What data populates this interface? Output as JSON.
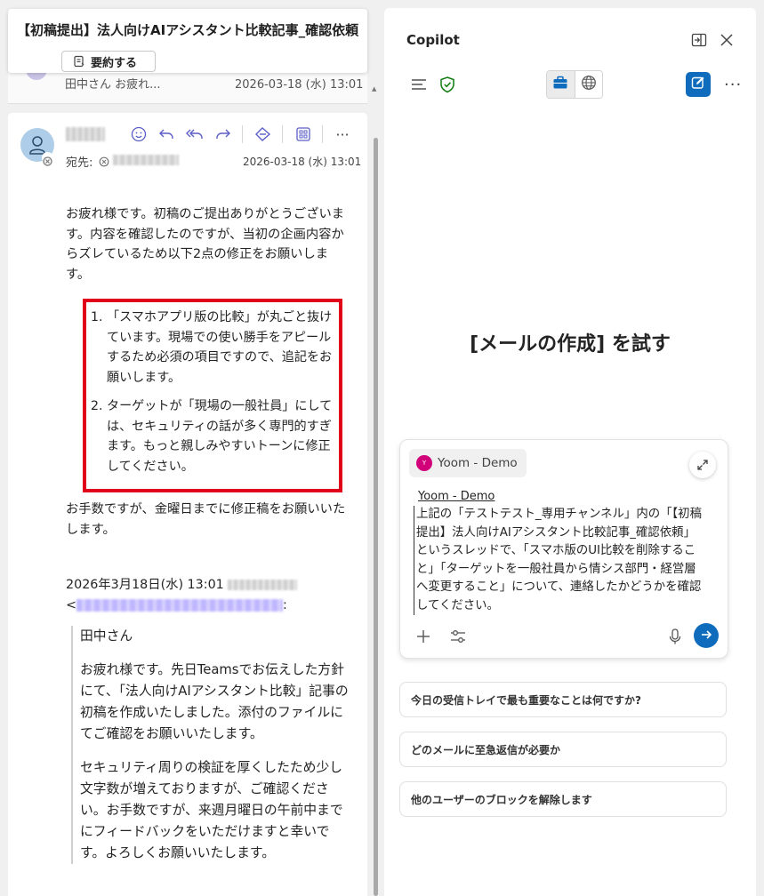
{
  "email": {
    "subject": "【初稿提出】法人向けAIアシスタント比較記事_確認依頼",
    "summarize_label": "要約する",
    "previous_item": {
      "from": "田中さん お疲れ...",
      "date": "2026-03-18 (水) 13:01"
    },
    "message": {
      "to_label": "宛先:",
      "date": "2026-03-18 (水) 13:01",
      "intro": "お疲れ様です。初稿のご提出ありがとうございます。内容を確認したのですが、当初の企画内容からズレているため以下2点の修正をお願いします。",
      "requests": [
        {
          "num": "1.",
          "text": "「スマホアプリ版の比較」が丸ごと抜けています。現場での使い勝手をアピールするため必須の項目ですので、追記をお願いします。"
        },
        {
          "num": "2.",
          "text": "ターゲットが「現場の一般社員」にしては、セキュリティの話が多く専門的すぎます。もっと親しみやすいトーンに修正してください。"
        }
      ],
      "closing": "お手数ですが、金曜日までに修正稿をお願いいたします。",
      "quote_header": "2026年3月18日(水) 13:01",
      "quote_email_suffix": ":",
      "quote_angle": "<",
      "quote": [
        "田中さん",
        "お疲れ様です。先日Teamsでお伝えした方針にて、「法人向けAIアシスタント比較」記事の初稿を作成いたしました。添付のファイルにてご確認をお願いいたします。",
        "セキュリティ周りの検証を厚くしたため少し文字数が増えておりますが、ご確認ください。お手数ですが、来週月曜日の午前中までにフィードバックをいただけますと幸いです。よろしくお願いいたします。"
      ]
    }
  },
  "copilot": {
    "title": "Copilot",
    "hero_title": "[メールの作成] を試す",
    "context_chip": "Yoom - Demo",
    "chip_initial": "Y",
    "mention": "Yoom  - Demo",
    "prompt": "上記の「テストテスト_専用チャンネル」内の「【初稿提出】法人向けAIアシスタント比較記事_確認依頼」というスレッドで、「スマホ版のUI比較を削除すること」「ターゲットを一般社員から情シス部門・経営層へ変更すること」について、連絡したかどうかを確認してください。",
    "suggestions": [
      "今日の受信トレイで最も重要なことは何ですか?",
      "どのメールに至急返信が必要か",
      "他のユーザーのブロックを解除します"
    ],
    "more_label": "···"
  },
  "colors": {
    "accent": "#0f6cbd",
    "highlight_border": "#e0001a",
    "shield": "#107c10"
  }
}
